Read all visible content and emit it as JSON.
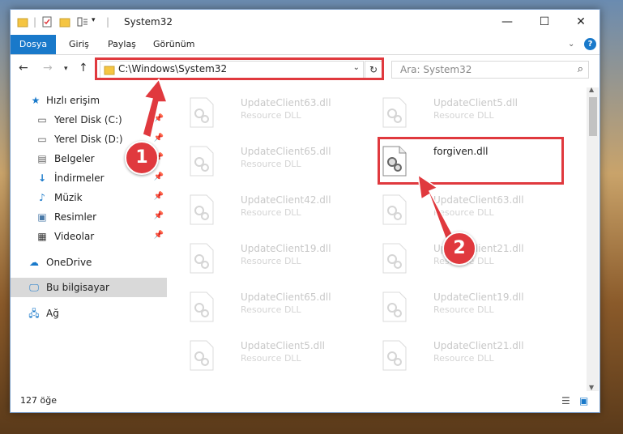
{
  "window": {
    "title": "System32",
    "minimize_icon": "minimize-icon",
    "maximize_icon": "maximize-icon",
    "close_icon": "close-icon"
  },
  "ribbon": {
    "tabs": [
      {
        "label": "Dosya",
        "active": true
      },
      {
        "label": "Giriş",
        "active": false
      },
      {
        "label": "Paylaş",
        "active": false
      },
      {
        "label": "Görünüm",
        "active": false
      }
    ]
  },
  "nav": {
    "address": "C:\\Windows\\System32",
    "search_placeholder": "Ara: System32"
  },
  "sidebar": {
    "items": [
      {
        "label": "Hızlı erişim",
        "icon": "star-icon",
        "pinned": false
      },
      {
        "label": "Yerel Disk (C:)",
        "icon": "drive-icon",
        "pinned": true
      },
      {
        "label": "Yerel Disk (D:)",
        "icon": "drive-icon",
        "pinned": true
      },
      {
        "label": "Belgeler",
        "icon": "documents-icon",
        "pinned": true
      },
      {
        "label": "İndirmeler",
        "icon": "download-icon",
        "pinned": true
      },
      {
        "label": "Müzik",
        "icon": "music-icon",
        "pinned": true
      },
      {
        "label": "Resimler",
        "icon": "pictures-icon",
        "pinned": true
      },
      {
        "label": "Videolar",
        "icon": "videos-icon",
        "pinned": true
      },
      {
        "label": "OneDrive",
        "icon": "cloud-icon",
        "pinned": false
      },
      {
        "label": "Bu bilgisayar",
        "icon": "computer-icon",
        "pinned": false,
        "selected": true
      },
      {
        "label": "Ağ",
        "icon": "network-icon",
        "pinned": false
      }
    ]
  },
  "files": {
    "left": [
      {
        "name": "UpdateClient63.dll",
        "type": "Resource DLL"
      },
      {
        "name": "UpdateClient65.dll",
        "type": "Resource DLL"
      },
      {
        "name": "UpdateClient42.dll",
        "type": "Resource DLL"
      },
      {
        "name": "UpdateClient19.dll",
        "type": "Resource DLL"
      },
      {
        "name": "UpdateClient65.dll",
        "type": "Resource DLL"
      },
      {
        "name": "UpdateClient5.dll",
        "type": "Resource DLL"
      }
    ],
    "right": [
      {
        "name": "UpdateClient5.dll",
        "type": "Resource DLL"
      },
      {
        "name": "forgiven.dll",
        "type": "",
        "highlight": true
      },
      {
        "name": "UpdateClient63.dll",
        "type": "Resource DLL"
      },
      {
        "name": "UpdateClient21.dll",
        "type": "Resource DLL"
      },
      {
        "name": "UpdateClient19.dll",
        "type": "Resource DLL"
      },
      {
        "name": "UpdateClient21.dll",
        "type": "Resource DLL"
      }
    ]
  },
  "status": {
    "item_count": "127 öğe"
  },
  "annotations": {
    "step1": "1",
    "step2": "2",
    "color": "#e0393e"
  }
}
